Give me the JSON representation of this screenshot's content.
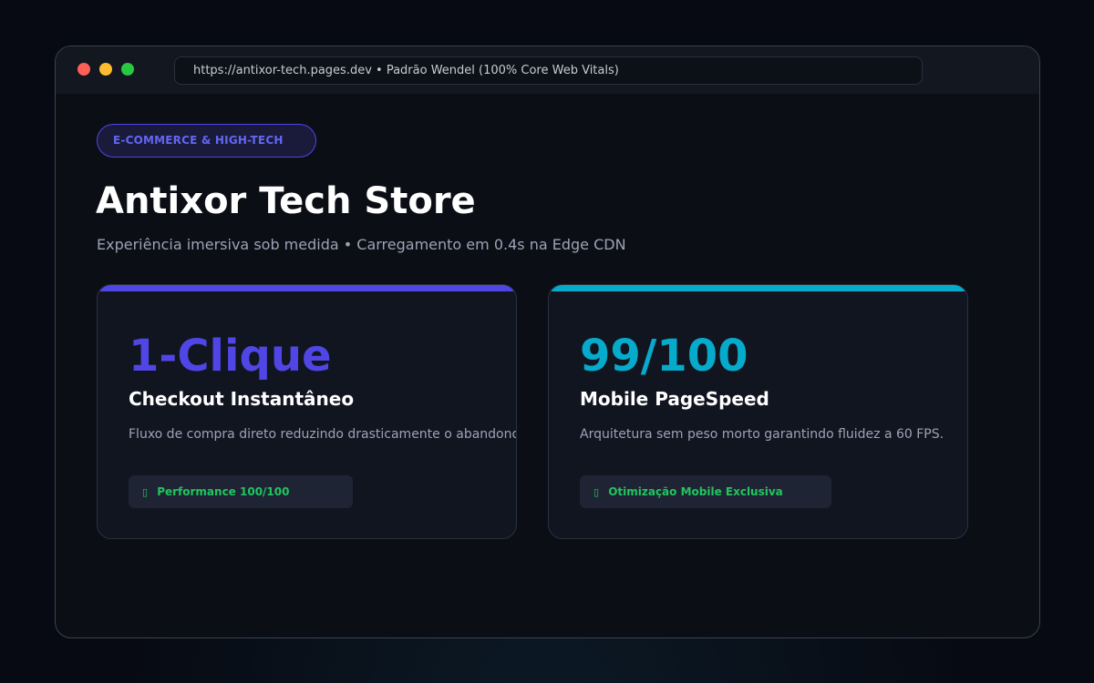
{
  "browser": {
    "url_text": "https://antixor-tech.pages.dev • Padrão Wendel (100% Core Web Vitals)"
  },
  "hero": {
    "badge": "E-COMMERCE & HIGH-TECH",
    "title": "Antixor Tech Store",
    "subtitle": "Experiência imersiva sob medida • Carregamento em 0.4s na Edge CDN"
  },
  "cards": [
    {
      "metric": "1-Clique",
      "title": "Checkout Instantâneo",
      "description": "Fluxo de compra direto reduzindo drasticamente o abandono.",
      "pill_icon": "▯",
      "pill_label": "Performance 100/100",
      "accent_color": "#4f46e5"
    },
    {
      "metric": "99/100",
      "title": "Mobile PageSpeed",
      "description": "Arquitetura sem peso morto garantindo fluidez a 60 FPS.",
      "pill_icon": "▯",
      "pill_label": "Otimização Mobile Exclusiva",
      "accent_color": "#06aacb"
    }
  ],
  "colors": {
    "background": "#070a12",
    "window": "#0b0e15",
    "success": "#22c55e"
  }
}
